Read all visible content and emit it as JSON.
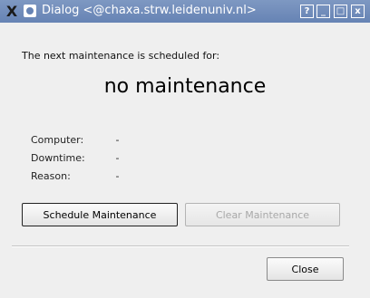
{
  "window": {
    "title": "Dialog <@chaxa.strw.leidenuniv.nl>",
    "app_icon": "X",
    "buttons": {
      "help": "?",
      "minimize": "_",
      "maximize": "□",
      "close": "x"
    }
  },
  "dialog": {
    "lead": "The next maintenance is scheduled for:",
    "status": "no maintenance",
    "fields": [
      {
        "label": "Computer:",
        "value": "-"
      },
      {
        "label": "Downtime:",
        "value": "-"
      },
      {
        "label": "Reason:",
        "value": "-"
      }
    ],
    "schedule_button": "Schedule Maintenance",
    "clear_button": "Clear Maintenance",
    "close_button": "Close"
  }
}
